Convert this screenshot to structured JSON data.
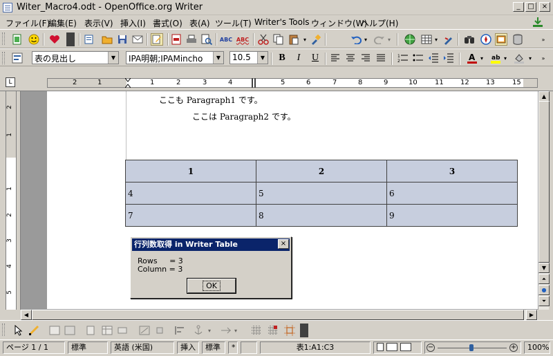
{
  "window": {
    "title": "Witer_Macro4.odt - OpenOffice.org  Writer",
    "minimize": "_",
    "maximize": "□",
    "close": "×"
  },
  "menu": [
    "ファイル(F)",
    "編集(E)",
    "表示(V)",
    "挿入(I)",
    "書式(O)",
    "表(A)",
    "ツール(T)",
    "Writer's Tools",
    "ウィンドウ(W)",
    "ヘルプ(H)"
  ],
  "format": {
    "style": "表の見出し",
    "font": "IPA明朝;IPAMincho",
    "size": "10.5",
    "bold": "B",
    "italic": "I",
    "underline": "U"
  },
  "ruler": {
    "tab_selector": "L",
    "numbers": [
      "2",
      "1",
      "1",
      "2",
      "3",
      "4",
      "5",
      "6",
      "7",
      "8",
      "9",
      "10",
      "11",
      "12",
      "13",
      "14",
      "15"
    ]
  },
  "vruler": {
    "numbers": [
      "2",
      "1",
      "1",
      "2",
      "3",
      "4",
      "5"
    ]
  },
  "document": {
    "para1": "ここも Paragraph1 です。",
    "para2": "ここは Paragraph2 です。",
    "table": {
      "header": [
        "1",
        "2",
        "3"
      ],
      "rows": [
        [
          "4",
          "5",
          "6"
        ],
        [
          "7",
          "8",
          "9"
        ]
      ]
    }
  },
  "dialog": {
    "title": "行列数取得 in Writer Table",
    "rows_line": "Rows     = 3",
    "column_line": "Column = 3",
    "ok": "OK",
    "close": "×"
  },
  "status": {
    "page": "ページ 1 / 1",
    "style": "標準",
    "language": "英語 (米国)",
    "insert": "挿入",
    "select": "標準",
    "modified": "*",
    "cell": "表1:A1:C3",
    "zoom": "100%"
  }
}
